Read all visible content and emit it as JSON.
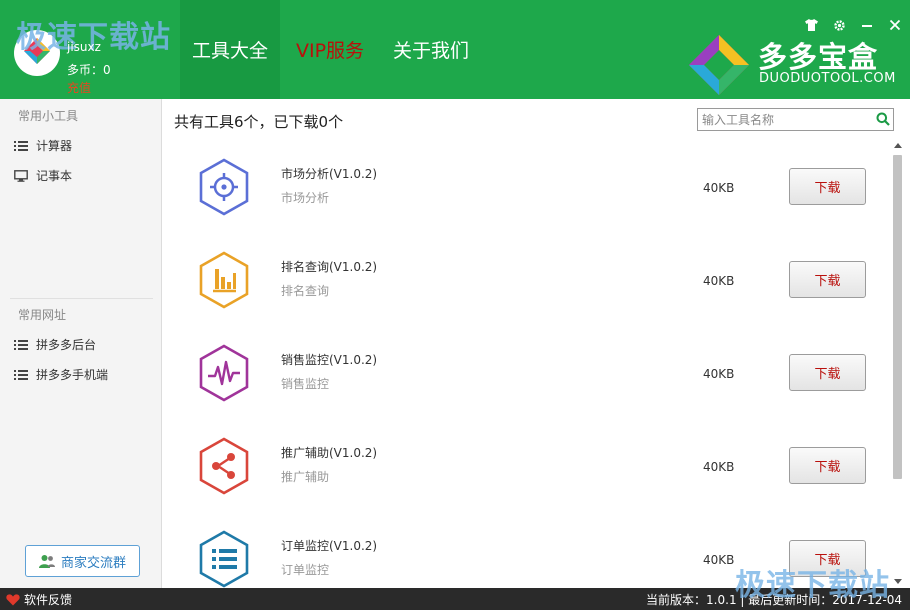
{
  "watermark": "极速下载站",
  "user": {
    "name": "jisuxz",
    "coins": "多币：0",
    "recharge": "充值"
  },
  "nav": {
    "tabs": [
      "工具大全",
      "VIP服务",
      "关于我们"
    ]
  },
  "brand": {
    "name": "多多宝盒",
    "sub": "DUODUOTOOL.COM"
  },
  "window_controls": [
    "shirt-icon",
    "gear-icon",
    "minimize-icon",
    "close-icon"
  ],
  "sidebar": {
    "tools_title": "常用小工具",
    "tools": [
      {
        "label": "计算器",
        "icon": "list-icon"
      },
      {
        "label": "记事本",
        "icon": "monitor-icon"
      }
    ],
    "sites_title": "常用网址",
    "sites": [
      {
        "label": "拼多多后台",
        "icon": "list-icon"
      },
      {
        "label": "拼多多手机端",
        "icon": "list-icon"
      }
    ],
    "group_button": "商家交流群"
  },
  "main": {
    "summary": "共有工具6个，已下载0个",
    "search_placeholder": "输入工具名称",
    "tools": [
      {
        "name": "市场分析(V1.0.2)",
        "desc": "市场分析",
        "size": "40KB",
        "button": "下载",
        "color": "#5b6fd6",
        "icon": "target-icon"
      },
      {
        "name": "排名查询(V1.0.2)",
        "desc": "排名查询",
        "size": "40KB",
        "button": "下载",
        "color": "#e9a227",
        "icon": "bar-chart-icon"
      },
      {
        "name": "销售监控(V1.0.2)",
        "desc": "销售监控",
        "size": "40KB",
        "button": "下载",
        "color": "#a0349a",
        "icon": "pulse-icon"
      },
      {
        "name": "推广辅助(V1.0.2)",
        "desc": "推广辅助",
        "size": "40KB",
        "button": "下载",
        "color": "#d9463b",
        "icon": "share-icon"
      },
      {
        "name": "订单监控(V1.0.2)",
        "desc": "订单监控",
        "size": "40KB",
        "button": "下载",
        "color": "#1f7aa8",
        "icon": "list-icon"
      }
    ]
  },
  "status": {
    "feedback": "软件反馈",
    "version": "当前版本：1.0.1 | 最后更新时间：2017-12-04"
  },
  "colors": {
    "header": "#1ea84b",
    "active_tab": "#189a42",
    "vip": "#b9100c",
    "statusbar": "#2a2a2a"
  }
}
